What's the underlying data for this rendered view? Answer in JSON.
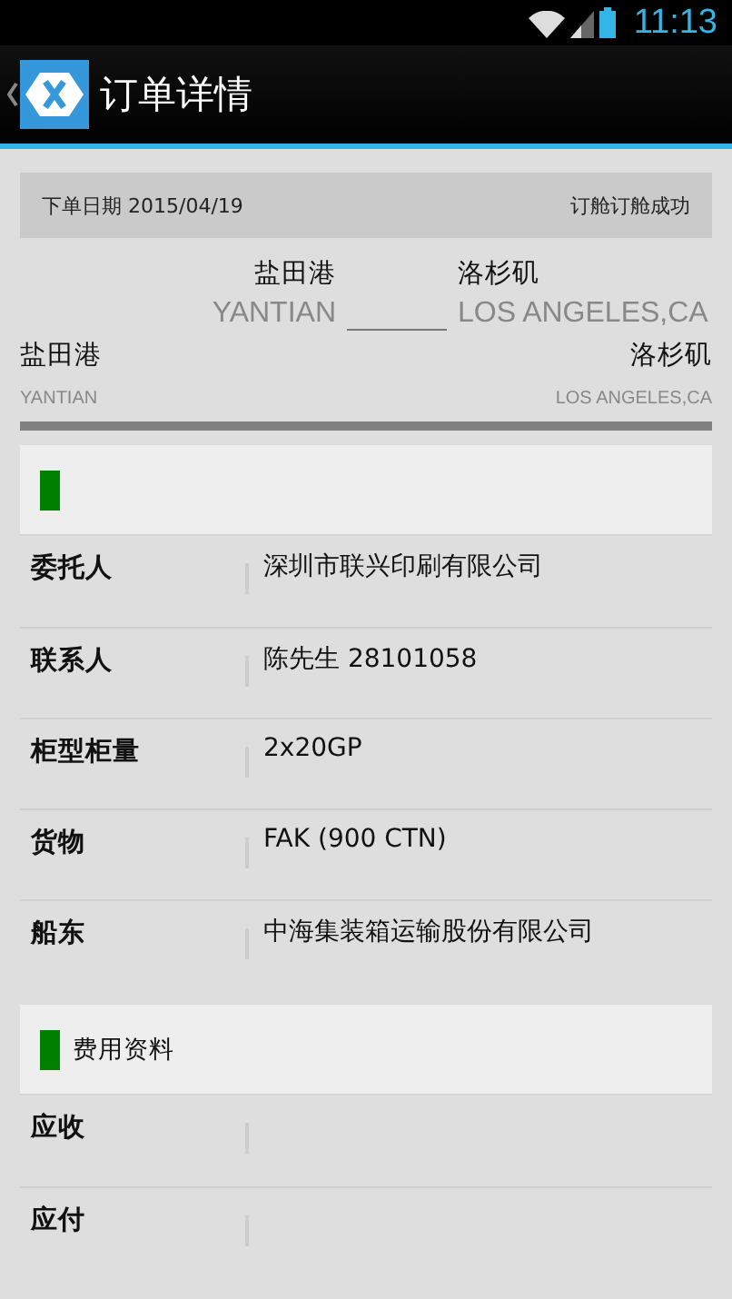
{
  "status_bar": {
    "time": "11:13"
  },
  "app_bar": {
    "title": "订单详情"
  },
  "order_header": {
    "date": "下单日期 2015/04/19",
    "status": "订舱订舱成功"
  },
  "route": {
    "origin_cn": "盐田港",
    "destination_cn": "洛杉矶",
    "origin_en": "YANTIAN",
    "destination_en": "LOS ANGELES,CA"
  },
  "route_detail": {
    "origin_cn": "盐田港",
    "destination_cn": "洛杉矶",
    "origin_en": "YANTIAN",
    "destination_en": "LOS ANGELES,CA"
  },
  "sections": [
    {
      "rows": [
        {
          "label": "委托人",
          "value": "深圳市联兴印刷有限公司"
        },
        {
          "label": "联系人",
          "value": "陈先生 28101058"
        },
        {
          "label": "柜型柜量",
          "value": "2x20GP"
        },
        {
          "label": "货物",
          "value": "FAK (900 CTN)"
        },
        {
          "label": "船东",
          "value": "中海集装箱运输股份有限公司"
        }
      ]
    },
    {
      "title": "费用资料",
      "rows": [
        {
          "label": "应收"
        },
        {
          "label": "应付"
        }
      ]
    }
  ]
}
